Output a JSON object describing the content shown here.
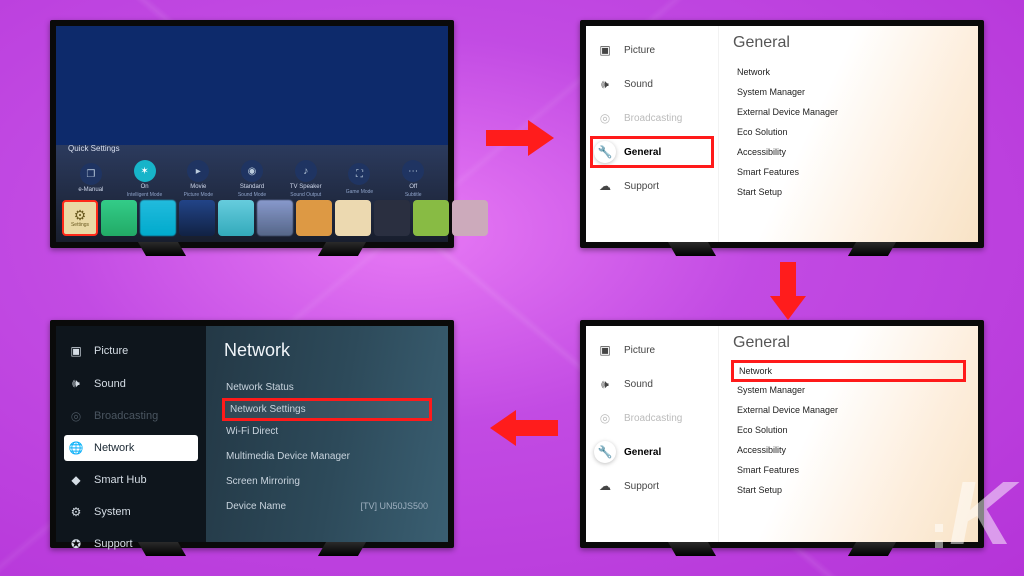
{
  "tv1": {
    "quick_settings_label": "Quick Settings",
    "items": [
      {
        "label": "e-Manual",
        "sub": ""
      },
      {
        "label": "On",
        "sub": "Intelligent Mode"
      },
      {
        "label": "Movie",
        "sub": "Picture Mode"
      },
      {
        "label": "Standard",
        "sub": "Sound Mode"
      },
      {
        "label": "TV Speaker",
        "sub": "Sound Output"
      },
      {
        "label": "",
        "sub": "Game Mode"
      },
      {
        "label": "Off",
        "sub": "Subtitle"
      }
    ],
    "settings_tile_label": "Settings"
  },
  "general_menu": {
    "title": "General",
    "sidebar": [
      {
        "label": "Picture"
      },
      {
        "label": "Sound"
      },
      {
        "label": "Broadcasting"
      },
      {
        "label": "General"
      },
      {
        "label": "Support"
      }
    ],
    "options": [
      "Network",
      "System Manager",
      "External Device Manager",
      "Eco Solution",
      "Accessibility",
      "Smart Features",
      "Start Setup"
    ]
  },
  "network_menu": {
    "title": "Network",
    "sidebar": [
      {
        "label": "Picture"
      },
      {
        "label": "Sound"
      },
      {
        "label": "Broadcasting"
      },
      {
        "label": "Network"
      },
      {
        "label": "Smart Hub"
      },
      {
        "label": "System"
      },
      {
        "label": "Support"
      }
    ],
    "options": [
      {
        "label": "Network Status",
        "value": ""
      },
      {
        "label": "Network Settings",
        "value": ""
      },
      {
        "label": "Wi-Fi Direct",
        "value": ""
      },
      {
        "label": "Multimedia Device Manager",
        "value": ""
      },
      {
        "label": "Screen Mirroring",
        "value": ""
      },
      {
        "label": "Device Name",
        "value": "[TV] UN50JS500"
      }
    ]
  }
}
